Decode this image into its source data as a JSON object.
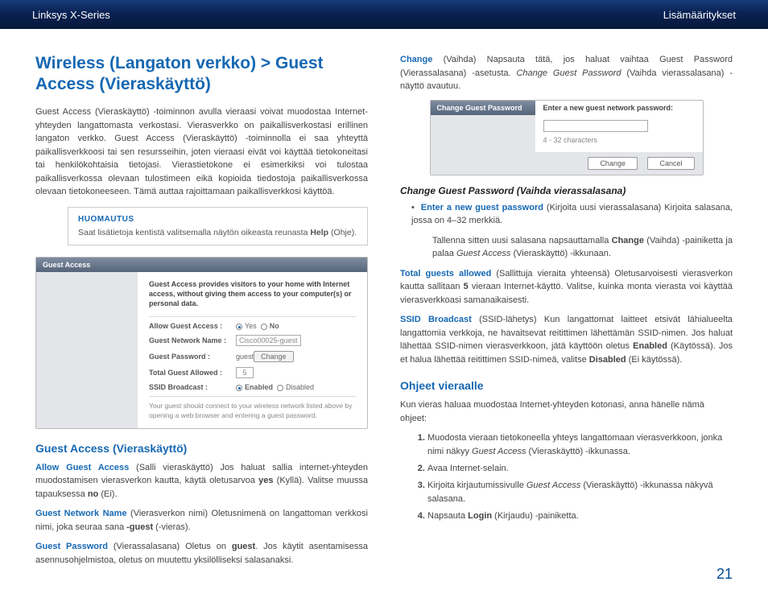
{
  "header": {
    "left": "Linksys X-Series",
    "right": "Lisämääritykset"
  },
  "leftcol": {
    "h1": "Wireless (Langaton verkko) > Guest Access (Vieraskäyttö)",
    "intro": "Guest Access (Vieraskäyttö) -toiminnon avulla vieraasi voivat muodostaa Internet-yhteyden langattomasta verkostasi. Vierasverkko on paikallisverkostasi erillinen langaton verkko. Guest Access (Vieraskäyttö) -toiminnolla ei saa yhteyttä paikallisverkkoosi tai sen resursseihin, joten vieraasi eivät voi käyttää tietokoneitasi tai henkilökohtaisia tietojasi. Vierastietokone ei esimerkiksi voi tulostaa paikallisverkossa olevaan tulostimeen eikä kopioida tiedostoja paikallisverkossa olevaan tietokoneeseen. Tämä auttaa rajoittamaan paikallisverkkosi käyttöä.",
    "note_title": "HUOMAUTUS",
    "note_body_a": "Saat lisätietoja kentistä valitsemalla näytön oikeasta reunasta ",
    "note_body_b": "Help",
    "note_body_c": " (Ohje).",
    "ui1": {
      "title": "Guest Access",
      "intro": "Guest Access provides visitors to your home with Internet access, without giving them access to your computer(s) or personal data.",
      "rows": {
        "allow": "Allow Guest Access :",
        "yes": "Yes",
        "no": "No",
        "name": "Guest Network Name :",
        "name_val": "Cisco00025-guest",
        "pass": "Guest Password :",
        "pass_val": "guest",
        "change": "Change",
        "total": "Total Guest Allowed :",
        "total_val": "5",
        "ssid": "SSID Broadcast :",
        "enabled": "Enabled",
        "disabled": "Disabled"
      },
      "foot": "Your guest should connect to your wireless network listed above by opening a web browser and entering a guest password."
    },
    "h2": "Guest Access (Vieraskäyttö)",
    "p_allow_term": "Allow Guest Access",
    "p_allow_rest": " (Salli vieraskäyttö) Jos haluat sallia internet-yhteyden muodostamisen vierasverkon kautta, käytä oletusarvoa ",
    "p_allow_yes": "yes",
    "p_allow_mid": " (Kyllä). Valitse muussa tapauksessa ",
    "p_allow_no": "no",
    "p_allow_end": " (Ei).",
    "p_name_term": "Guest Network Name",
    "p_name_rest": " (Vierasverkon nimi) Oletusnimenä on langattoman verkkosi nimi, joka seuraa sana ",
    "p_name_suffix": "-guest",
    "p_name_end": " (-vieras).",
    "p_pass_term": "Guest Password",
    "p_pass_rest": " (Vierassalasana) Oletus on ",
    "p_pass_val": "guest",
    "p_pass_end": ". Jos käytit asentamisessa asennusohjelmistoa, oletus on muutettu yksilölliseksi salasanaksi."
  },
  "rightcol": {
    "p_change_term": "Change",
    "p_change_rest": " (Vaihda) Napsauta tätä, jos haluat vaihtaa Guest Password (Vierassalasana) -asetusta. ",
    "p_change_em": "Change Guest Password",
    "p_change_end": " (Vaihda vierassalasana) -näyttö avautuu.",
    "ui2": {
      "tab": "Change Guest Password",
      "prompt": "Enter a new guest network password:",
      "hint": "4 - 32 characters",
      "change": "Change",
      "cancel": "Cancel"
    },
    "h3": "Change Guest Password (Vaihda vierassalasana)",
    "bul_term": "Enter a new guest password",
    "bul_rest": " (Kirjoita uusi vierassalasana) Kirjoita salasana, jossa on 4–32 merkkiä.",
    "bul2_a": "Tallenna sitten uusi salasana napsauttamalla ",
    "bul2_b": "Change",
    "bul2_c": " (Vaihda) -painiketta ja palaa ",
    "bul2_em": "Guest Access",
    "bul2_d": " (Vieraskäyttö) -ikkunaan.",
    "p_total_term": "Total guests allowed",
    "p_total_rest": " (Sallittuja vieraita yhteensä) Oletusarvoisesti vierasverkon kautta sallitaan ",
    "p_total_num": "5",
    "p_total_end": " vieraan Internet-käyttö. Valitse, kuinka monta vierasta voi käyttää vierasverkkoasi samanaikaisesti.",
    "p_ssid_term": "SSID Broadcast",
    "p_ssid_rest": " (SSID-lähetys) Kun langattomat laitteet etsivät lähialueelta langattomia verkkoja, ne havaitsevat reitittimen lähettämän SSID-nimen. Jos haluat lähettää SSID-nimen vierasverkkoon, jätä käyttöön oletus ",
    "p_ssid_en": "Enabled",
    "p_ssid_mid": " (Käytössä). Jos et halua lähettää reitittimen SSID-nimeä, valitse ",
    "p_ssid_dis": "Disabled",
    "p_ssid_end": " (Ei käytössä).",
    "h2b": "Ohjeet vieraalle",
    "p_ohj": "Kun vieras haluaa muodostaa Internet-yhteyden kotonasi, anna hänelle nämä ohjeet:",
    "s1a": "Muodosta vieraan tietokoneella yhteys langattomaan vierasverkkoon, jonka nimi näkyy ",
    "s1em": "Guest Access",
    "s1b": " (Vieraskäyttö) -ikkunassa.",
    "s2": "Avaa Internet-selain.",
    "s3a": "Kirjoita kirjautumissivulle ",
    "s3em": "Guest Access",
    "s3b": " (Vieraskäyttö) -ikkunassa näkyvä salasana.",
    "s4a": "Napsauta ",
    "s4b": "Login",
    "s4c": " (Kirjaudu) -painiketta."
  },
  "pagenum": "21"
}
